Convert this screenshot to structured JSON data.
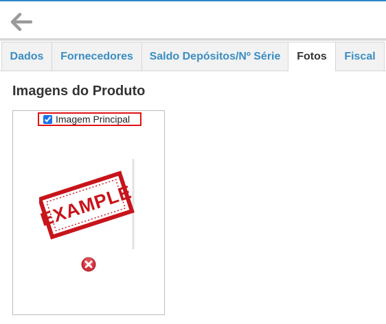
{
  "topbar": {
    "back_icon": "arrow-left-icon"
  },
  "tabs": [
    {
      "label": "Dados",
      "active": false
    },
    {
      "label": "Fornecedores",
      "active": false
    },
    {
      "label": "Saldo Depósitos/Nº Série",
      "active": false
    },
    {
      "label": "Fotos",
      "active": true
    },
    {
      "label": "Fiscal",
      "active": false
    }
  ],
  "photos": {
    "title": "Imagens do Produto",
    "items": [
      {
        "principal_label": "Imagem Principal",
        "principal_checked": true,
        "image_stamp_text": "EXAMPLE",
        "delete_icon": "delete-x-icon"
      }
    ]
  },
  "colors": {
    "accent": "#3a8dc4",
    "highlight_border": "#e01010",
    "stamp": "#c8141b"
  }
}
